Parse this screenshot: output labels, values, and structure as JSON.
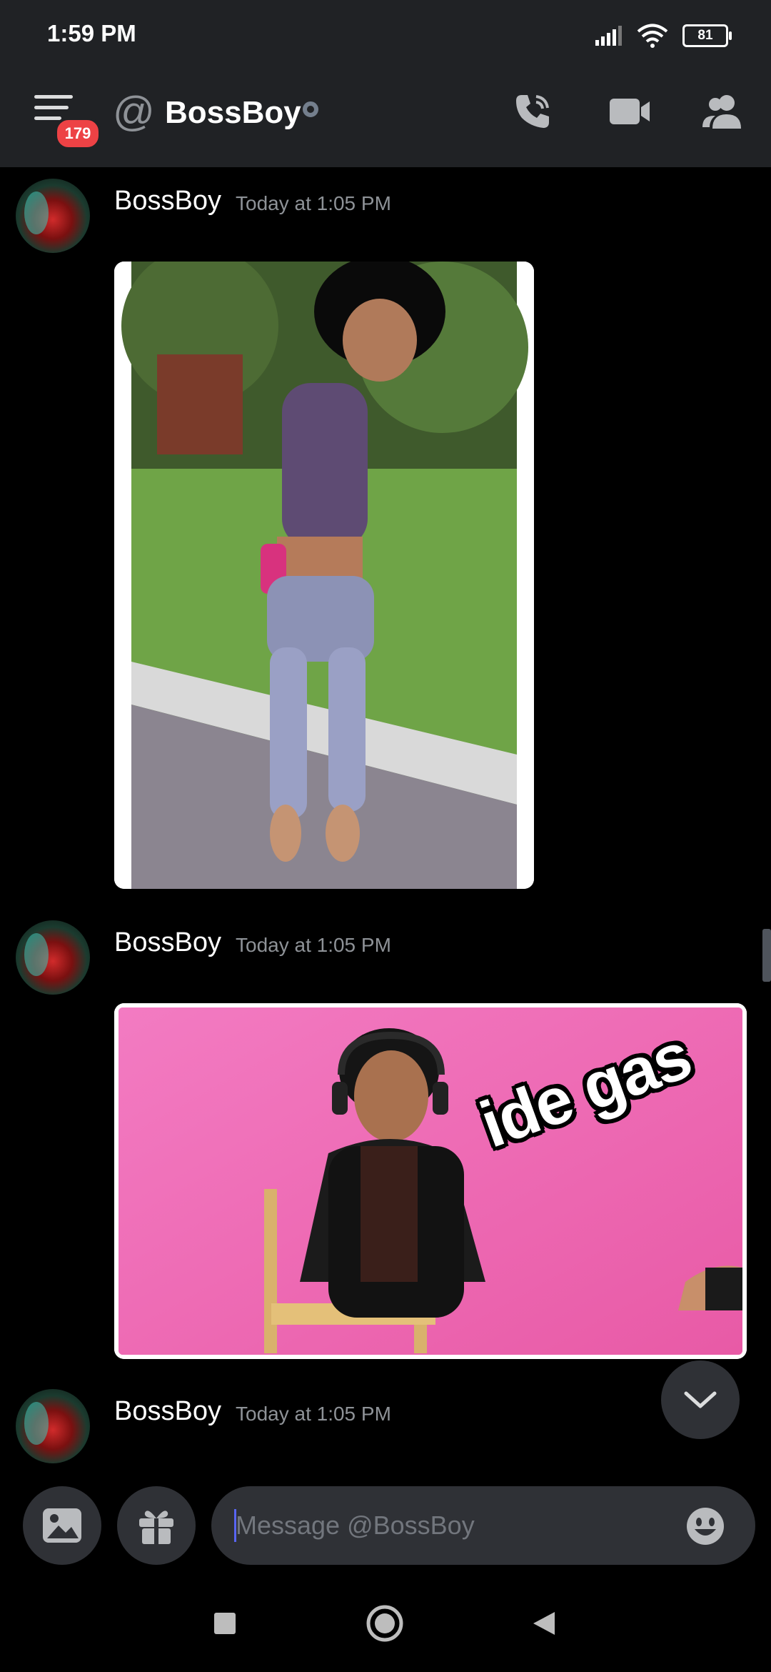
{
  "status_bar": {
    "time": "1:59 PM",
    "battery": "81",
    "icons": [
      "signal-icon",
      "wifi-icon",
      "battery-icon"
    ]
  },
  "header": {
    "unread_badge": "179",
    "at_symbol": "@",
    "title": "BossBoy",
    "status": "offline",
    "icons": [
      "voice-call-icon",
      "video-call-icon",
      "members-icon"
    ]
  },
  "messages": [
    {
      "author": "BossBoy",
      "timestamp": "Today at 1:05 PM",
      "attachment": "image"
    },
    {
      "author": "BossBoy",
      "timestamp": "Today at 1:05 PM",
      "attachment": "image",
      "overlay_text": "ide gas"
    },
    {
      "author": "BossBoy",
      "timestamp": "Today at 1:05 PM"
    }
  ],
  "composer": {
    "placeholder": "Message @BossBoy",
    "value": ""
  },
  "colors": {
    "background": "#000000",
    "header_bg": "#202225",
    "input_bg": "#2f3136",
    "badge_red": "#ed4245",
    "timestamp_gray": "#8e9297",
    "caret_blurple": "#5865f2"
  }
}
